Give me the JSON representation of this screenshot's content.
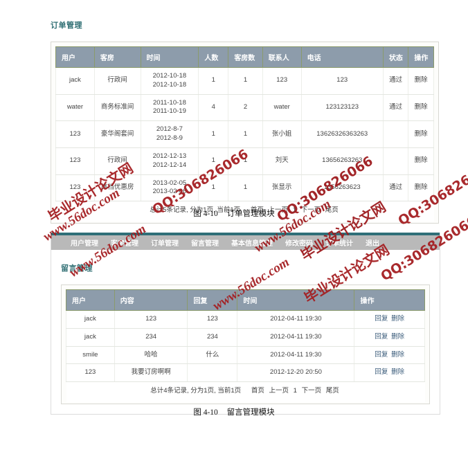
{
  "figure_one": {
    "section_title": "订单管理",
    "columns": [
      "用户",
      "客房",
      "时间",
      "人数",
      "客房数",
      "联系人",
      "电话",
      "状态",
      "操作"
    ],
    "rows": [
      {
        "user": "jack",
        "room": "行政间",
        "time": "2012-10-18\n2012-10-18",
        "people": "1",
        "rooms": "1",
        "contact": "123",
        "phone": "123",
        "status": "通过",
        "op": "删除"
      },
      {
        "user": "water",
        "room": "商务标准间",
        "time": "2011-10-18\n2011-10-19",
        "people": "4",
        "rooms": "2",
        "contact": "water",
        "phone": "123123123",
        "status": "通过",
        "op": "删除"
      },
      {
        "user": "123",
        "room": "豪华阁套间",
        "time": "2012-8-7\n2012-8-9",
        "people": "1",
        "rooms": "1",
        "contact": "张小姐",
        "phone": "13626326363263",
        "status": "",
        "op": "删除"
      },
      {
        "user": "123",
        "room": "行政间",
        "time": "2012-12-13\n2012-12-14",
        "people": "1",
        "rooms": "1",
        "contact": "刘天",
        "phone": "13656263263",
        "status": "",
        "op": "删除"
      },
      {
        "user": "123",
        "room": "高档优惠房",
        "time": "2013-02-05\n2013-02-06",
        "people": "1",
        "rooms": "1",
        "contact": "张显示",
        "phone": "1356263623",
        "status": "通过",
        "op": "删除"
      }
    ],
    "pager": {
      "summary": "总计5条记录, 分为1页, 当前1页",
      "first": "首页",
      "prev": "上一页",
      "current": "1",
      "next": "下一页",
      "last": "尾页"
    },
    "caption_number": "图 4-10",
    "caption_text": "订单管理模块"
  },
  "figure_two": {
    "nav_items": [
      "用户管理",
      "客房管理",
      "订单管理",
      "留言管理",
      "基本信息管理",
      "修改密码",
      "订单统计",
      "退出"
    ],
    "section_title": "留言管理",
    "columns": [
      "用户",
      "内容",
      "回复",
      "时间",
      "操作"
    ],
    "rows": [
      {
        "user": "jack",
        "content": "123",
        "reply": "123",
        "time": "2012-04-11 19:30",
        "op_reply": "回复",
        "op_delete": "删除"
      },
      {
        "user": "jack",
        "content": "234",
        "reply": "234",
        "time": "2012-04-11 19:30",
        "op_reply": "回复",
        "op_delete": "删除"
      },
      {
        "user": "smile",
        "content": "哈哈",
        "reply": "什么",
        "time": "2012-04-11 19:30",
        "op_reply": "回复",
        "op_delete": "删除"
      },
      {
        "user": "123",
        "content": "我要订房啊啊",
        "reply": "",
        "time": "2012-12-20 20:50",
        "op_reply": "回复",
        "op_delete": "删除"
      }
    ],
    "pager": {
      "summary": "总计4条记录, 分为1页, 当前1页",
      "first": "首页",
      "prev": "上一页",
      "current": "1",
      "next": "下一页",
      "last": "尾页"
    },
    "caption_number": "图 4-10",
    "caption_text": "留言管理模块"
  },
  "watermarks": {
    "site_cn": "毕业设计论文网",
    "site_url": "www.56doc.com",
    "qq": "QQ:306826066"
  },
  "colors": {
    "heading_teal": "#2d6d72",
    "table_header": "#8d9cab",
    "header_border": "#8a9a6b",
    "navbar": "#b9b9b9",
    "top_strip": "#2f6f78",
    "watermark_red": "#a51f22",
    "link": "#3a5b7a"
  }
}
